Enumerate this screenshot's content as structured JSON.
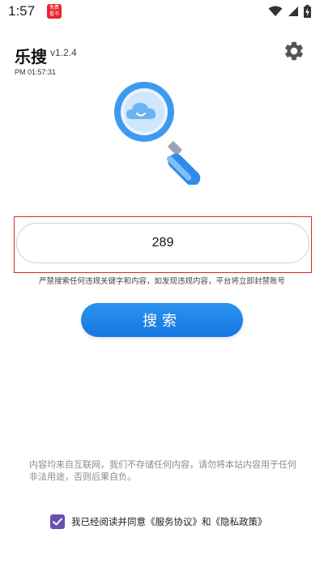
{
  "status_bar": {
    "time": "1:57",
    "badge_line1": "免费",
    "badge_line2": "看书",
    "icons": [
      "wifi-icon",
      "signal-icon",
      "battery-charging-icon"
    ]
  },
  "header": {
    "app_name": "乐搜",
    "version": "v1.2.4",
    "clock": "PM 01:57:31",
    "settings_icon": "gear-icon"
  },
  "search": {
    "value": "289",
    "warning": "严禁搜索任何违规关键字和内容，如发现违规内容，平台将立即封禁账号",
    "button_label": "搜索"
  },
  "disclaimer": "内容均来自互联网，我们不存储任何内容，请勿将本站内容用于任何非法用途，否则后果自负。",
  "agreement": {
    "checked": true,
    "prefix": "我已经阅读并同意",
    "service_link": "《服务协议》",
    "joiner": "和",
    "privacy_link": "《隐私政策》"
  },
  "colors": {
    "accent": "#1a7fe8",
    "checkbox": "#6a4fb3",
    "highlight_frame": "#d42a2a",
    "magnifier_rim": "#3d9af0",
    "magnifier_handle": "#2f8de8"
  }
}
